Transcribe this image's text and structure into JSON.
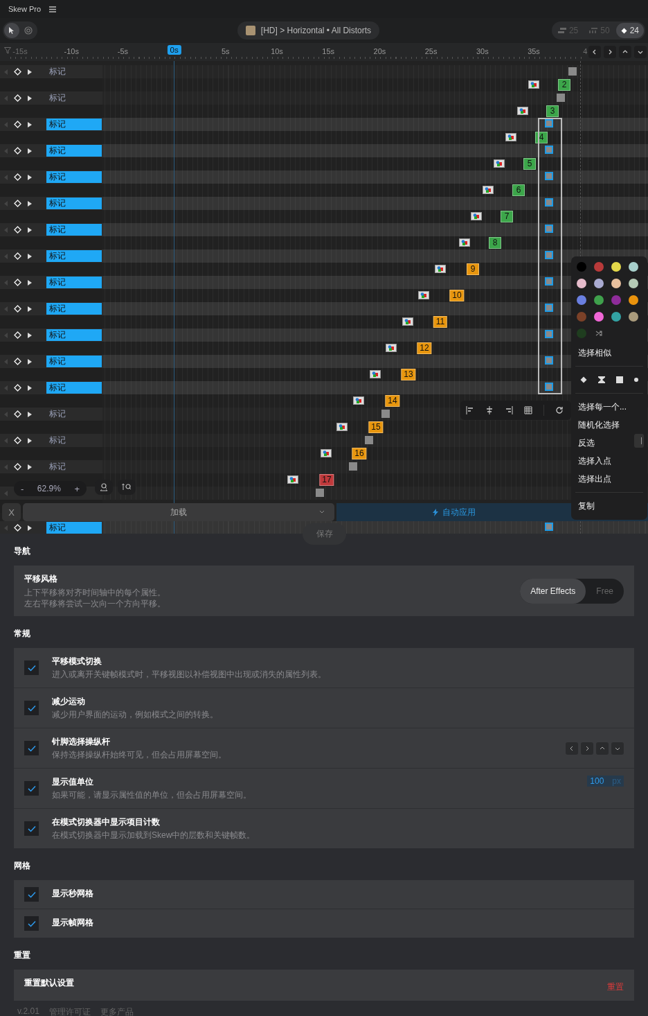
{
  "app": {
    "title": "Skew Pro"
  },
  "toolbar": {
    "tools": [
      {
        "kind": "pointer",
        "selected": true
      },
      {
        "kind": "target",
        "selected": false
      }
    ],
    "breadcrumb": {
      "color": "#a89272",
      "text": "[HD] > Horizontal • All Distorts"
    },
    "counts": [
      {
        "kind": "layers",
        "value": "25",
        "selected": false
      },
      {
        "kind": "properties",
        "value": "50",
        "selected": false
      },
      {
        "kind": "keyframes",
        "value": "24",
        "selected": true
      }
    ]
  },
  "ruler": {
    "ticks": [
      {
        "label": "-15s",
        "faded": true,
        "selected": false
      },
      {
        "label": "-10s",
        "faded": false,
        "selected": false
      },
      {
        "label": "-5s",
        "faded": false,
        "selected": false
      },
      {
        "label": "0s",
        "faded": false,
        "selected": true
      },
      {
        "label": "5s",
        "faded": false,
        "selected": false
      },
      {
        "label": "10s",
        "faded": false,
        "selected": false
      },
      {
        "label": "15s",
        "faded": false,
        "selected": false
      },
      {
        "label": "20s",
        "faded": false,
        "selected": false
      },
      {
        "label": "25s",
        "faded": false,
        "selected": false
      },
      {
        "label": "30s",
        "faded": false,
        "selected": false
      },
      {
        "label": "35s",
        "faded": false,
        "selected": false
      },
      {
        "label": "4",
        "faded": true,
        "selected": false
      }
    ]
  },
  "timeline": {
    "layers": [
      {
        "label": "标记",
        "selected": false,
        "clip": {
          "number": "2",
          "color": "#3ca64a"
        }
      },
      {
        "label": "标记",
        "selected": false,
        "clip": {
          "number": "3",
          "color": "#3ca64a"
        }
      },
      {
        "label": "标记",
        "selected": true,
        "clip": {
          "number": "4",
          "color": "#3ca64a"
        }
      },
      {
        "label": "标记",
        "selected": true,
        "clip": {
          "number": "5",
          "color": "#3ca64a"
        }
      },
      {
        "label": "标记",
        "selected": true,
        "clip": {
          "number": "6",
          "color": "#3ca64a"
        }
      },
      {
        "label": "标记",
        "selected": true,
        "clip": {
          "number": "7",
          "color": "#3ca64a"
        }
      },
      {
        "label": "标记",
        "selected": true,
        "clip": {
          "number": "8",
          "color": "#3ca64a"
        }
      },
      {
        "label": "标记",
        "selected": true,
        "clip": {
          "number": "9",
          "color": "#e8960e"
        }
      },
      {
        "label": "标记",
        "selected": true,
        "clip": {
          "number": "10",
          "color": "#e8960e"
        }
      },
      {
        "label": "标记",
        "selected": true,
        "clip": {
          "number": "11",
          "color": "#e8960e"
        }
      },
      {
        "label": "标记",
        "selected": true,
        "clip": {
          "number": "12",
          "color": "#e8960e"
        }
      },
      {
        "label": "标记",
        "selected": true,
        "clip": {
          "number": "13",
          "color": "#e8960e"
        }
      },
      {
        "label": "标记",
        "selected": true,
        "clip": {
          "number": "14",
          "color": "#e8960e"
        }
      },
      {
        "label": "标记",
        "selected": false,
        "clip": {
          "number": "15",
          "color": "#e8960e"
        }
      },
      {
        "label": "标记",
        "selected": false,
        "clip": {
          "number": "16",
          "color": "#e8960e"
        }
      },
      {
        "label": "标记",
        "selected": false,
        "clip": {
          "number": "17",
          "color": "#c0393b"
        }
      },
      {
        "selected": false
      },
      {
        "label": "标记",
        "selected": true
      }
    ]
  },
  "zoom": {
    "minus": "-",
    "value": "62.9%",
    "plus": "+"
  },
  "context_menu": {
    "colors": [
      {
        "color": "#000000"
      },
      {
        "color": "#b83a3a"
      },
      {
        "color": "#e3d84a"
      },
      {
        "color": "#a7cfcb"
      },
      {
        "color": "#e6bccb"
      },
      {
        "color": "#a9aad0"
      },
      {
        "color": "#e8c09e"
      },
      {
        "color": "#b5cab5"
      },
      {
        "color": "#6a7fe0"
      },
      {
        "color": "#3fa04c"
      },
      {
        "color": "#8e2c9a"
      },
      {
        "color": "#ea930d"
      },
      {
        "color": "#7b4128"
      },
      {
        "color": "#f067d6"
      },
      {
        "color": "#33a3a4"
      },
      {
        "color": "#aa9b7c"
      },
      {
        "color": "#1f3d1f"
      }
    ],
    "select_similar": "选择相似",
    "shapes": [
      {
        "kind": "diamond"
      },
      {
        "kind": "hourglass"
      },
      {
        "kind": "square"
      },
      {
        "kind": "dot"
      }
    ],
    "items": [
      "选择每一个...",
      "随机化选择",
      "反选",
      "选择入点",
      "选择出点"
    ],
    "copy": "复制"
  },
  "load_bar": {
    "close": "X",
    "select": "加载",
    "auto_apply": "自动应用"
  },
  "save": "保存",
  "settings": {
    "navigation": {
      "heading": "导航",
      "title": "平移风格",
      "description_lines": [
        "上下平移将对齐时间轴中的每个属性。",
        "左右平移将尝试一次向一个方向平移。"
      ],
      "options": [
        {
          "label": "After Effects",
          "selected": true
        },
        {
          "label": "Free",
          "selected": false
        }
      ]
    },
    "general": {
      "heading": "常规",
      "items": [
        {
          "kind": "plain",
          "title": "平移模式切换",
          "description": "进入或离开关键帧模式时，平移视图以补偿视图中出现或消失的属性列表。",
          "checked": true
        },
        {
          "kind": "plain",
          "title": "减少运动",
          "description": "减少用户界面的运动，例如模式之间的转换。",
          "checked": true
        },
        {
          "kind": "nav",
          "title": "针脚选择操纵杆",
          "description": "保持选择操纵杆始终可见，但会占用屏幕空间。",
          "checked": true
        },
        {
          "kind": "unit",
          "title": "显示值单位",
          "description": "如果可能，请显示属性值的单位，但会占用屏幕空间。",
          "checked": true,
          "value": "100",
          "unit": "px"
        },
        {
          "kind": "plain",
          "title": "在模式切换器中显示项目计数",
          "description": "在模式切换器中显示加载到Skew中的层数和关键帧数。",
          "checked": true
        }
      ]
    },
    "grid": {
      "heading": "网格",
      "items": [
        {
          "title": "显示秒网格",
          "checked": true
        },
        {
          "title": "显示帧网格",
          "checked": true
        }
      ]
    },
    "reset": {
      "heading": "重置",
      "title": "重置默认设置",
      "action": "重置"
    }
  },
  "footer": {
    "version": "v.2.01",
    "links": [
      "管理许可证",
      "更多产品"
    ]
  }
}
